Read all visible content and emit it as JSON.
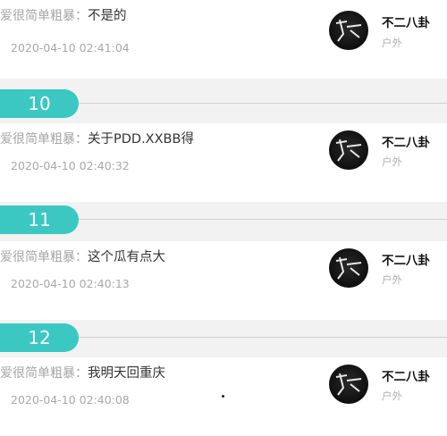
{
  "comments": [
    {
      "number": "",
      "prefix": "爱很简单粗暴：",
      "content": "不是的",
      "time": "2020-04-10 02:41:04",
      "author": "不二八卦",
      "category": "户外"
    },
    {
      "number": "10",
      "prefix": "爱很简单粗暴：",
      "content": "关于PDD.XXBB得",
      "time": "2020-04-10 02:40:32",
      "author": "不二八卦",
      "category": "户外"
    },
    {
      "number": "11",
      "prefix": "爱很简单粗暴：",
      "content": "这个瓜有点大",
      "time": "2020-04-10 02:40:13",
      "author": "不二八卦",
      "category": "户外"
    },
    {
      "number": "12",
      "prefix": "爱很简单粗暴：",
      "content": "我明天回重庆",
      "time": "2020-04-10 02:40:08",
      "author": "不二八卦",
      "category": "户外"
    }
  ],
  "colors": {
    "accent": "#3bc8c3",
    "background": "#f2f2f2",
    "card": "#ffffff"
  },
  "icons": {
    "avatar": "avatar-icon"
  }
}
